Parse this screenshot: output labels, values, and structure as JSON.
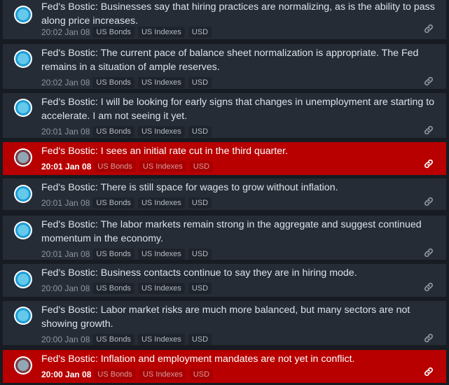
{
  "colors": {
    "item_bg": "#262c36",
    "important_bg": "#b80000",
    "page_bg": "#171b22",
    "avatar_ring": "#1c9bd6"
  },
  "icons": {
    "avatar": "circle-avatar-icon",
    "link": "chain-link-icon"
  },
  "feed": {
    "items": [
      {
        "headline": "Fed's Bostic: Businesses say that hiring practices are normalizing, as is the ability to pass along price increases.",
        "time": "20:02 Jan 08",
        "tags": [
          "US Bonds",
          "US Indexes",
          "USD"
        ],
        "important": false
      },
      {
        "headline": "Fed's Bostic: The current pace of balance sheet normalization is appropriate. The Fed remains in a situation of ample reserves.",
        "time": "20:02 Jan 08",
        "tags": [
          "US Bonds",
          "US Indexes",
          "USD"
        ],
        "important": false
      },
      {
        "headline": "Fed's Bostic: I will be looking for early signs that changes in unemployment are starting to accelerate. I am not seeing it yet.",
        "time": "20:01 Jan 08",
        "tags": [
          "US Bonds",
          "US Indexes",
          "USD"
        ],
        "important": false
      },
      {
        "headline": "Fed's Bostic: I sees an initial rate cut in the third quarter.",
        "time": "20:01 Jan 08",
        "tags": [
          "US Bonds",
          "US Indexes",
          "USD"
        ],
        "important": true
      },
      {
        "headline": "Fed's Bostic: There is still space for wages to grow without inflation.",
        "time": "20:01 Jan 08",
        "tags": [
          "US Bonds",
          "US Indexes",
          "USD"
        ],
        "important": false
      },
      {
        "headline": "Fed's Bostic: The labor markets remain strong in the aggregate and suggest continued momentum in the economy.",
        "time": "20:01 Jan 08",
        "tags": [
          "US Bonds",
          "US Indexes",
          "USD"
        ],
        "important": false
      },
      {
        "headline": "Fed's Bostic: Business contacts continue to say they are in hiring mode.",
        "time": "20:00 Jan 08",
        "tags": [
          "US Bonds",
          "US Indexes",
          "USD"
        ],
        "important": false
      },
      {
        "headline": "Fed's Bostic: Labor market risks are much more balanced, but many sectors are not showing growth.",
        "time": "20:00 Jan 08",
        "tags": [
          "US Bonds",
          "US Indexes",
          "USD"
        ],
        "important": false
      },
      {
        "headline": "Fed's Bostic: Inflation and employment mandates are not yet in conflict.",
        "time": "20:00 Jan 08",
        "tags": [
          "US Bonds",
          "US Indexes",
          "USD"
        ],
        "important": true
      }
    ]
  }
}
